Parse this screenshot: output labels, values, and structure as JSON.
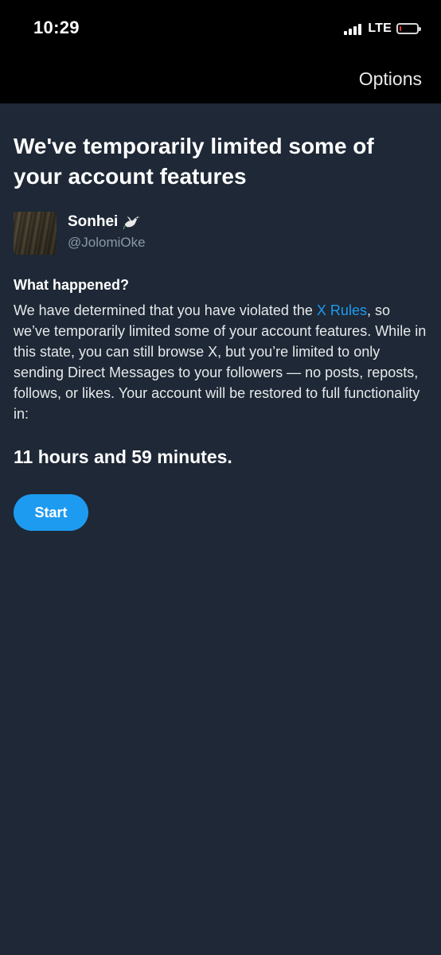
{
  "status_bar": {
    "time": "10:29",
    "network": "LTE",
    "signal_bars": 4,
    "battery_level": 0.1,
    "battery_color": "#ff3b30"
  },
  "header": {
    "options_label": "Options"
  },
  "page": {
    "title": "We've temporarily limited some of your account features"
  },
  "account": {
    "display_name": "Sonhei",
    "name_emoji_icon": "dove-icon",
    "handle": "@JolomiOke"
  },
  "notice": {
    "heading": "What happened?",
    "body_before_link": "We have determined that you have violated the ",
    "link_text": "X Rules",
    "body_after_link": ", so we’ve temporarily limited some of your account features. While in this state, you can still browse X, but you’re limited to only sending Direct Messages to your followers — no posts, reposts, follows, or likes. Your account will be restored to full functionality in:",
    "time_remaining": "11 hours and 59 minutes."
  },
  "actions": {
    "start_label": "Start"
  },
  "colors": {
    "background": "#1e2836",
    "accent": "#1d9bf0",
    "secondary_text": "#8b98a5"
  }
}
